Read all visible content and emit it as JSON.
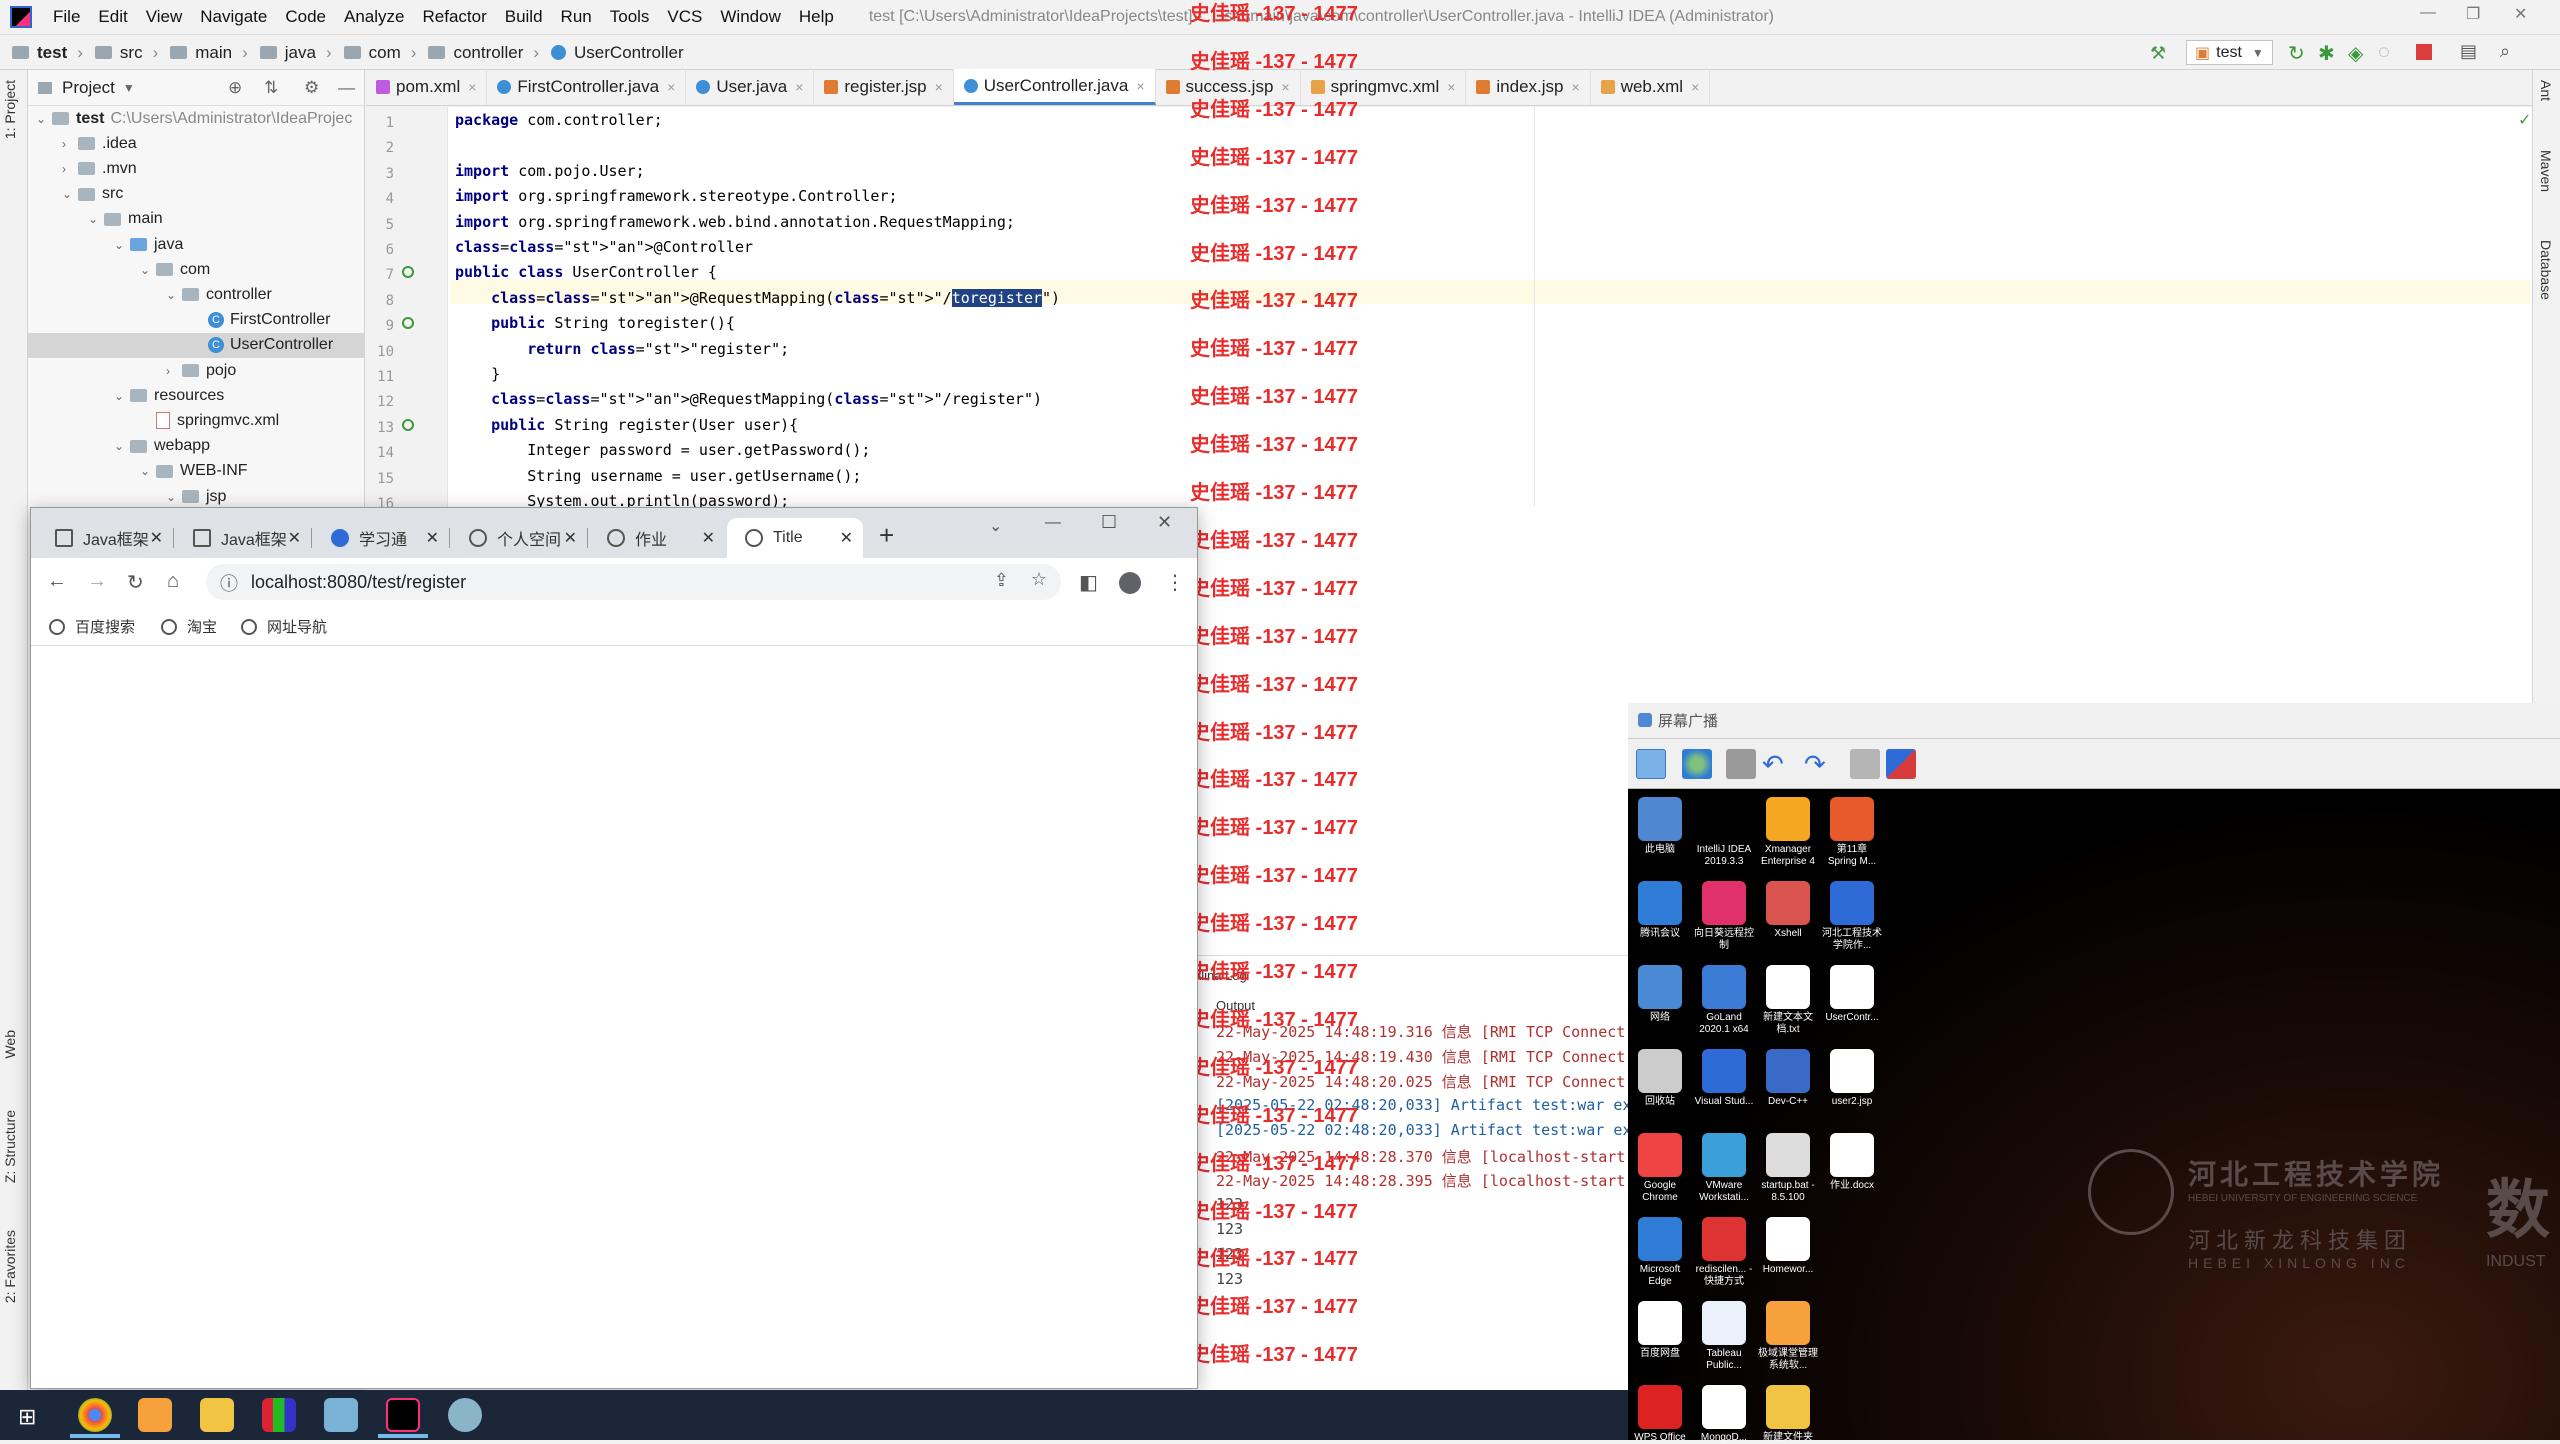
{
  "ide": {
    "window_title": "test [C:\\Users\\Administrator\\IdeaProjects\\test] - ...\\src\\main\\java\\com\\controller\\UserController.java - IntelliJ IDEA (Administrator)",
    "menu": [
      "File",
      "Edit",
      "View",
      "Navigate",
      "Code",
      "Analyze",
      "Refactor",
      "Build",
      "Run",
      "Tools",
      "VCS",
      "Window",
      "Help"
    ],
    "breadcrumbs": [
      "test",
      "src",
      "main",
      "java",
      "com",
      "controller",
      "UserController"
    ],
    "run_config": "test",
    "left_stripe": [
      "1: Project",
      "Web",
      "Z: Structure",
      "2: Favorites"
    ],
    "right_stripe": [
      "Ant",
      "Maven",
      "Database"
    ],
    "project_panel": {
      "title": "Project",
      "tree": [
        {
          "label": "test",
          "path": "C:\\Users\\Administrator\\IdeaProjec",
          "depth": 0,
          "icon": "folder"
        },
        {
          "label": ".idea",
          "depth": 1,
          "icon": "folder"
        },
        {
          "label": ".mvn",
          "depth": 1,
          "icon": "folder"
        },
        {
          "label": "src",
          "depth": 1,
          "icon": "folder"
        },
        {
          "label": "main",
          "depth": 2,
          "icon": "folder"
        },
        {
          "label": "java",
          "depth": 3,
          "icon": "folder-blue"
        },
        {
          "label": "com",
          "depth": 4,
          "icon": "folder"
        },
        {
          "label": "controller",
          "depth": 5,
          "icon": "folder"
        },
        {
          "label": "FirstController",
          "depth": 6,
          "icon": "class"
        },
        {
          "label": "UserController",
          "depth": 6,
          "icon": "class",
          "selected": true
        },
        {
          "label": "pojo",
          "depth": 5,
          "icon": "folder"
        },
        {
          "label": "resources",
          "depth": 3,
          "icon": "folder"
        },
        {
          "label": "springmvc.xml",
          "depth": 4,
          "icon": "xml"
        },
        {
          "label": "webapp",
          "depth": 3,
          "icon": "folder"
        },
        {
          "label": "WEB-INF",
          "depth": 4,
          "icon": "folder"
        },
        {
          "label": "jsp",
          "depth": 5,
          "icon": "folder"
        }
      ]
    },
    "editor_tabs": [
      {
        "label": "pom.xml",
        "icon": "m"
      },
      {
        "label": "FirstController.java",
        "icon": "c"
      },
      {
        "label": "User.java",
        "icon": "c"
      },
      {
        "label": "register.jsp",
        "icon": "j"
      },
      {
        "label": "UserController.java",
        "icon": "c",
        "active": true
      },
      {
        "label": "success.jsp",
        "icon": "j"
      },
      {
        "label": "springmvc.xml",
        "icon": "x"
      },
      {
        "label": "index.jsp",
        "icon": "j"
      },
      {
        "label": "web.xml",
        "icon": "x"
      }
    ],
    "code_lines": [
      "package com.controller;",
      "",
      "import com.pojo.User;",
      "import org.springframework.stereotype.Controller;",
      "import org.springframework.web.bind.annotation.RequestMapping;",
      "@Controller",
      "public class UserController {",
      "    @RequestMapping(\"/toregister\")",
      "    public String toregister(){",
      "        return \"register\";",
      "    }",
      "    @RequestMapping(\"/register\")",
      "    public String register(User user){",
      "        Integer password = user.getPassword();",
      "        String username = user.getUsername();",
      "        System.out.println(password);"
    ],
    "watermark": "史佳瑶 -137 - 1477",
    "run_tabs": [
      "alina Log",
      "Output"
    ],
    "console": [
      {
        "text": "22-May-2025 14:48:19.316 信息 [RMI TCP Connect",
        "kind": "info"
      },
      {
        "text": "22-May-2025 14:48:19.430 信息 [RMI TCP Connect",
        "kind": "info"
      },
      {
        "text": "22-May-2025 14:48:20.025 信息 [RMI TCP Connect",
        "kind": "info"
      },
      {
        "text": "[2025-05-22 02:48:20,033] Artifact test:war ex",
        "kind": "art"
      },
      {
        "text": "[2025-05-22 02:48:20,033] Artifact test:war ex",
        "kind": "art"
      },
      {
        "text": "22-May-2025 14:48:28.370 信息 [localhost-start",
        "kind": "info"
      },
      {
        "text": "22-May-2025 14:48:28.395 信息 [localhost-start",
        "kind": "info"
      },
      {
        "text": "123",
        "kind": "out"
      },
      {
        "text": "123",
        "kind": "out"
      },
      {
        "text": "123",
        "kind": "out"
      },
      {
        "text": "123",
        "kind": "out"
      }
    ]
  },
  "browser": {
    "tabs": [
      "Java框架",
      "Java框架",
      "学习通",
      "个人空间",
      "作业",
      "Title"
    ],
    "url": "localhost:8080/test/register",
    "bookmarks": [
      "百度搜索",
      "淘宝",
      "网址导航"
    ]
  },
  "broadcast": {
    "title": "屏幕广播",
    "desktop_icons": [
      "此电脑",
      "IntelliJ IDEA 2019.3.3",
      "Xmanager Enterprise 4",
      "第11章 Spring M...",
      "腾讯会议",
      "向日葵远程控制",
      "Xshell",
      "河北工程技术学院作...",
      "网络",
      "GoLand 2020.1 x64",
      "新建文本文档.txt",
      "UserContr...",
      "回收站",
      "Visual Stud...",
      "Dev-C++",
      "user2.jsp",
      "Google Chrome",
      "VMware Workstati...",
      "startup.bat - 8.5.100",
      "作业.docx",
      "Microsoft Edge",
      "rediscilen... - 快捷方式",
      "Homewor...",
      "",
      "百度网盘",
      "Tableau Public...",
      "极域课堂管理系统软...",
      "",
      "WPS Office",
      "MongoD...",
      "新建文件夹",
      ""
    ],
    "logo_text": [
      "河北工程技术学院",
      "HEBEI UNIVERSITY OF ENGINEERING SCIENCE",
      "河北新龙科技集团",
      "HEBEI XINLONG INC",
      "数",
      "INDUST"
    ]
  }
}
